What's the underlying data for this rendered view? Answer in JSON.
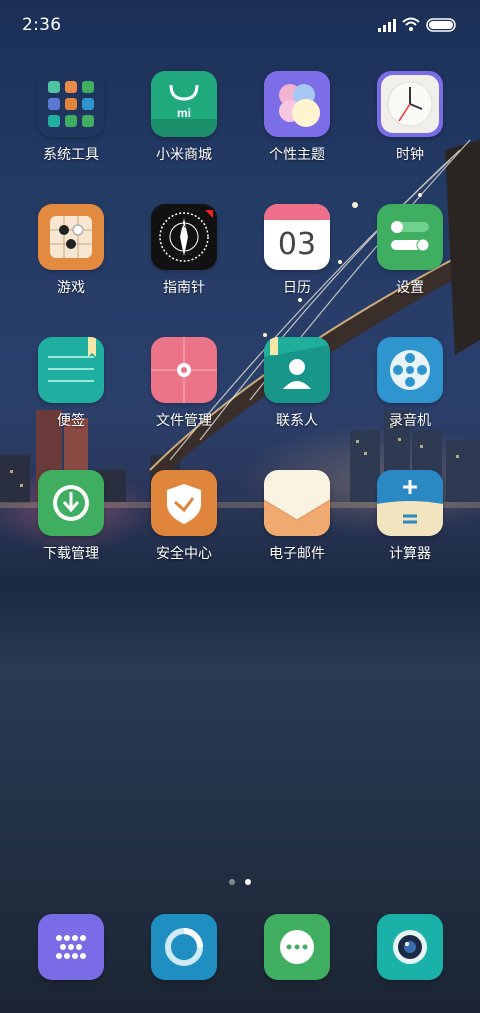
{
  "status_bar": {
    "time": "2:36"
  },
  "apps": [
    {
      "label": "系统工具",
      "icon": "system-tools-icon"
    },
    {
      "label": "小米商城",
      "icon": "mi-store-icon"
    },
    {
      "label": "个性主题",
      "icon": "themes-icon"
    },
    {
      "label": "时钟",
      "icon": "clock-icon"
    },
    {
      "label": "游戏",
      "icon": "games-icon"
    },
    {
      "label": "指南针",
      "icon": "compass-icon"
    },
    {
      "label": "日历",
      "icon": "calendar-icon",
      "date": "03"
    },
    {
      "label": "设置",
      "icon": "settings-icon"
    },
    {
      "label": "便签",
      "icon": "notes-icon"
    },
    {
      "label": "文件管理",
      "icon": "file-manager-icon"
    },
    {
      "label": "联系人",
      "icon": "contacts-icon"
    },
    {
      "label": "录音机",
      "icon": "recorder-icon"
    },
    {
      "label": "下载管理",
      "icon": "downloads-icon"
    },
    {
      "label": "安全中心",
      "icon": "security-icon"
    },
    {
      "label": "电子邮件",
      "icon": "email-icon"
    },
    {
      "label": "计算器",
      "icon": "calculator-icon"
    }
  ],
  "page_indicator": {
    "pages": 2,
    "active": 2
  },
  "dock": [
    {
      "icon": "app-drawer-icon"
    },
    {
      "icon": "browser-icon"
    },
    {
      "icon": "messages-icon"
    },
    {
      "icon": "camera-icon"
    }
  ],
  "colors": {
    "mi_store": "#20a97c",
    "themes": "#7c6ee6",
    "games": "#e28a3f",
    "settings": "#3fae61",
    "notes": "#1fb0a2",
    "file_manager": "#eb7488",
    "contacts": "#1fae9a",
    "recorder": "#2f95cf",
    "downloads": "#3fae61",
    "security": "#e0853c",
    "calculator": "#2a88c3",
    "drawer": "#7a6be6",
    "browser": "#1f8fc2",
    "messages": "#3fae61",
    "camera": "#1ab2a8"
  }
}
